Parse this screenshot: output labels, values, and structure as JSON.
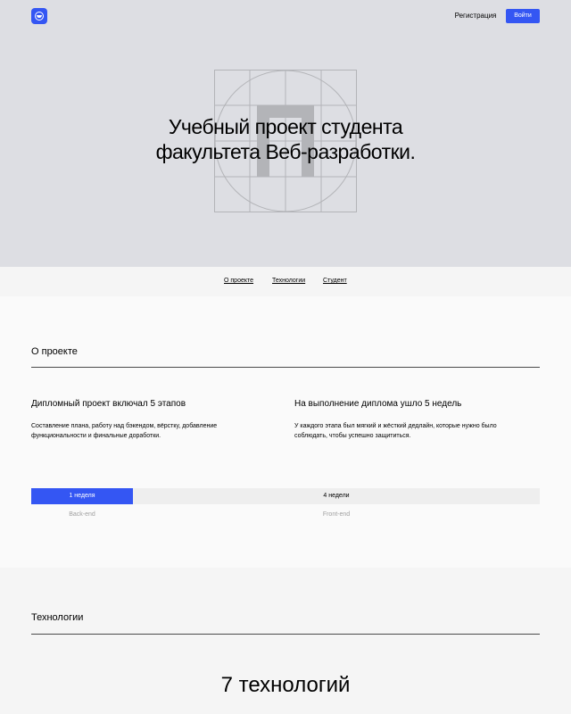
{
  "header": {
    "register_label": "Регистрация",
    "login_label": "Войти",
    "brand_color": "#3456f3"
  },
  "hero": {
    "title_line1": "Учебный проект студента",
    "title_line2": "факультета Веб-разработки.",
    "emblem_icon": "p-letter-grid-emblem",
    "background": "#dddee3"
  },
  "nav": {
    "items": [
      {
        "label": "О проекте"
      },
      {
        "label": "Технологии"
      },
      {
        "label": "Студент"
      }
    ]
  },
  "about": {
    "title": "О проекте",
    "columns": [
      {
        "heading": "Дипломный проект включал 5 этапов",
        "text": "Составление плана, работу над бэкендом, вёрстку, добавление функциональности и финальные доработки."
      },
      {
        "heading": "На выполнение диплома ушло 5 недель",
        "text": "У каждого этапа был мягкий и жёсткий дедлайн, которые нужно было соблюдать, чтобы успешно защититься."
      }
    ],
    "timeline": {
      "backend_duration": "1 неделя",
      "frontend_duration": "4 недели",
      "backend_label": "Back-end",
      "frontend_label": "Front-end",
      "backend_fraction": 0.2
    }
  },
  "tech": {
    "title": "Технологии",
    "count_text": "7 технологий"
  }
}
